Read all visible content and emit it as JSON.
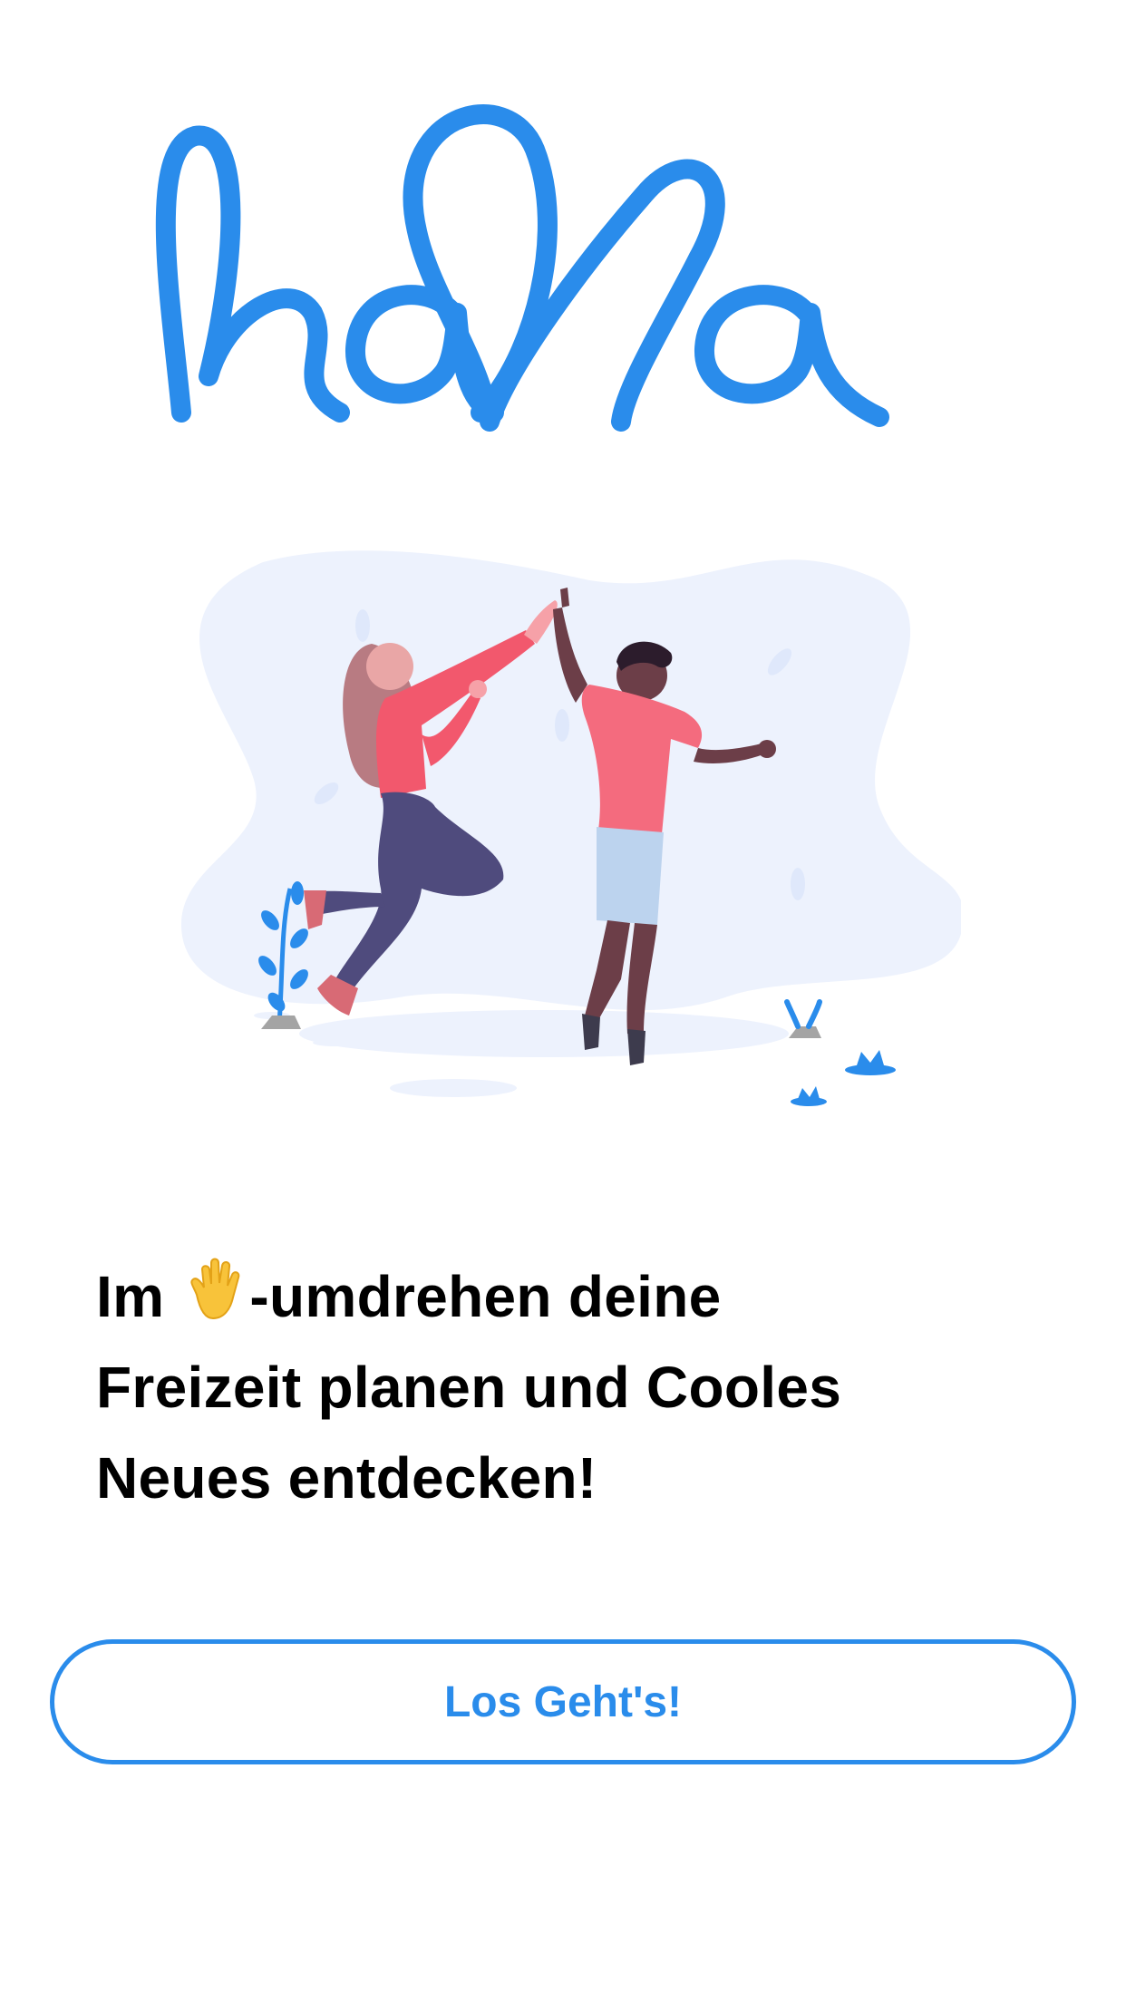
{
  "brand": {
    "logo_text": "halla",
    "accent_color": "#2a8ceb"
  },
  "illustration": {
    "icon": "high-five-illustration"
  },
  "headline": {
    "prefix": "Im",
    "emoji": "raised-hand-icon",
    "line1_rest": "-umdrehen deine",
    "line2": "Freizeit planen und Cooles",
    "line3": "Neues entdecken!"
  },
  "cta": {
    "label": "Los Geht's!"
  }
}
